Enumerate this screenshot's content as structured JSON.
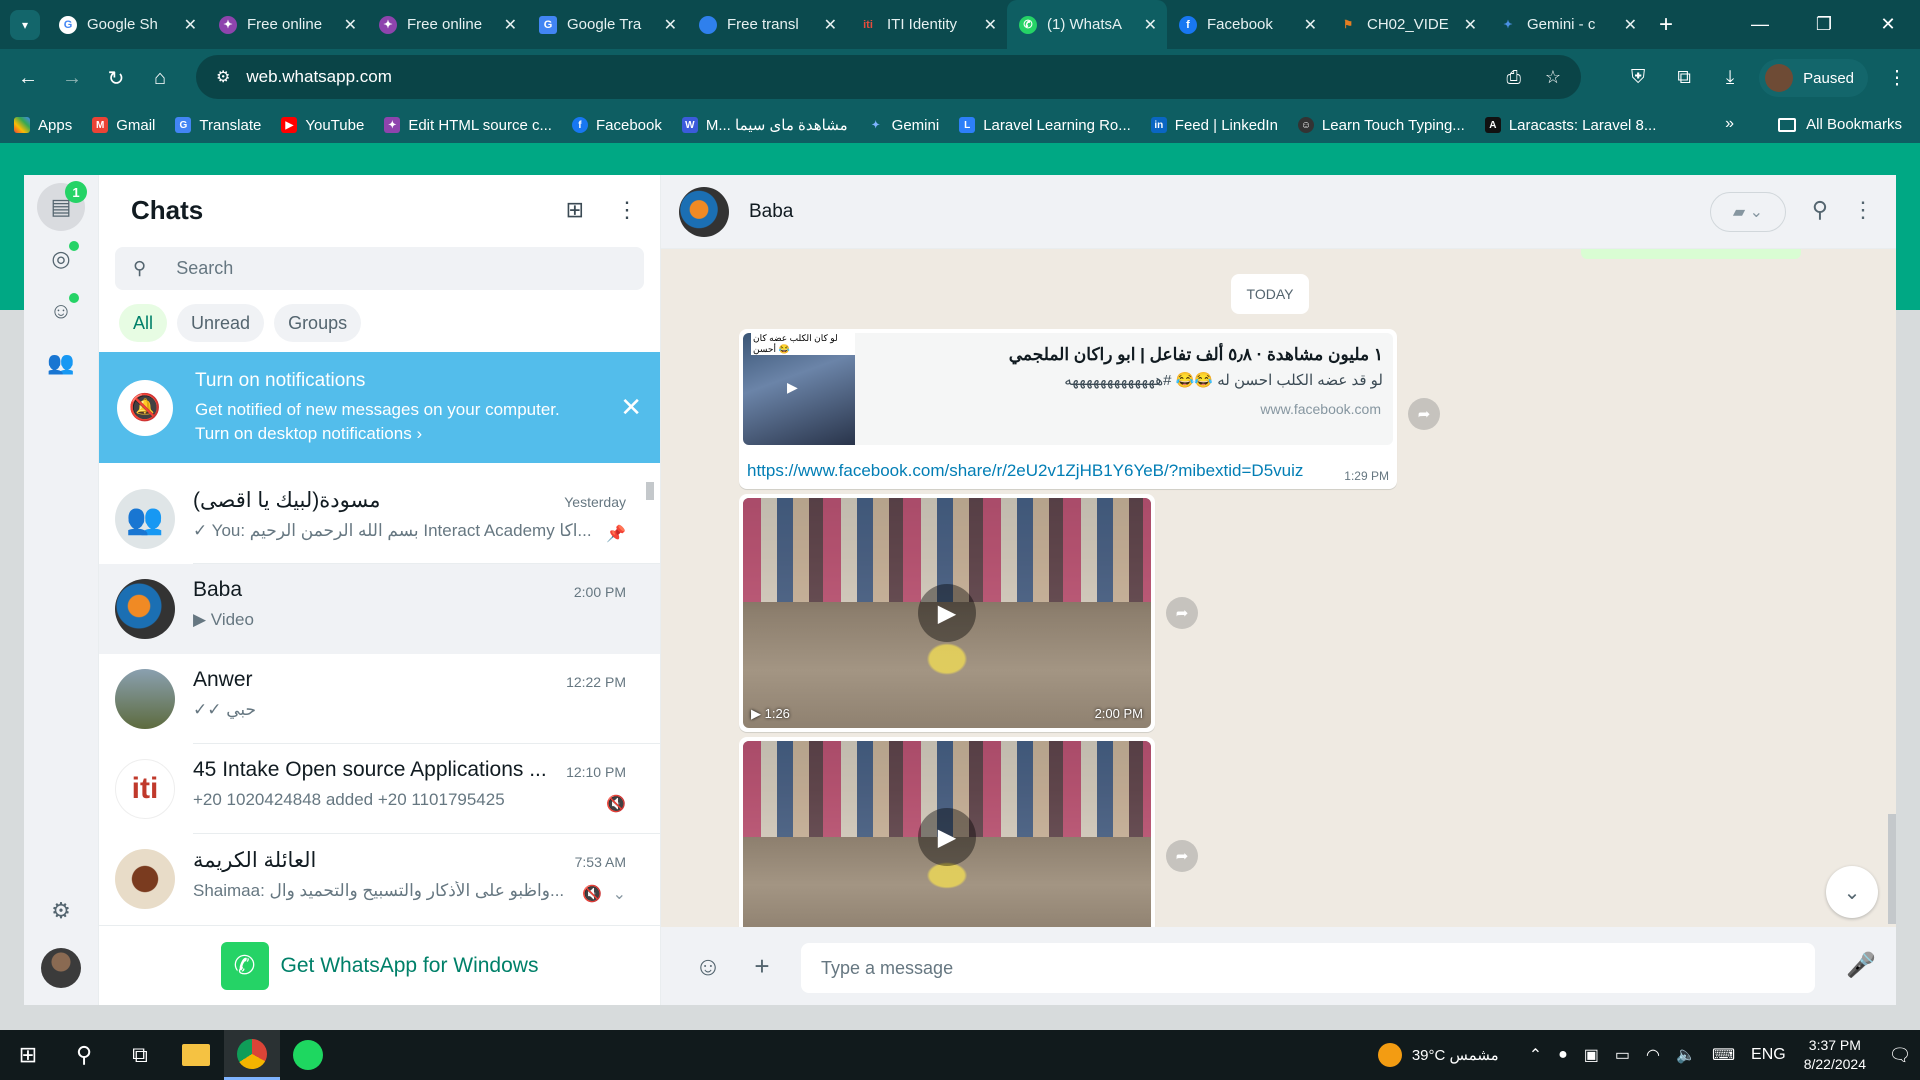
{
  "browser": {
    "tabs": [
      {
        "title": "Google Sh",
        "icon": "google-icon",
        "color": "#ffffff"
      },
      {
        "title": "Free online",
        "icon": "puzzle-icon",
        "color": "#8e44ad"
      },
      {
        "title": "Free online",
        "icon": "puzzle-icon",
        "color": "#8e44ad"
      },
      {
        "title": "Google Tra",
        "icon": "translate-icon",
        "color": "#4285f4"
      },
      {
        "title": "Free transl",
        "icon": "globe-icon",
        "color": "#2f80ed"
      },
      {
        "title": "ITI Identity",
        "icon": "iti-icon",
        "color": "#c0392b"
      },
      {
        "title": "(1) WhatsA",
        "icon": "whatsapp-icon",
        "color": "#25d366"
      },
      {
        "title": "Facebook",
        "icon": "facebook-icon",
        "color": "#1877f2"
      },
      {
        "title": "CH02_VIDE",
        "icon": "file-icon",
        "color": "#e67e22"
      },
      {
        "title": "Gemini - c",
        "icon": "gemini-icon",
        "color": "#4a90e2"
      }
    ],
    "url": "web.whatsapp.com",
    "profile_label": "Paused",
    "bookmarks": [
      {
        "label": "Apps",
        "color": "#e74c3c"
      },
      {
        "label": "Gmail",
        "color": "#ea4335"
      },
      {
        "label": "Translate",
        "color": "#4285f4"
      },
      {
        "label": "YouTube",
        "color": "#ff0000"
      },
      {
        "label": "Edit HTML source c...",
        "color": "#8e44ad"
      },
      {
        "label": "Facebook",
        "color": "#1877f2"
      },
      {
        "label": "M... مشاهدة ماى سيما",
        "color": "#3b5bdb"
      },
      {
        "label": "Gemini",
        "color": "#4a90e2"
      },
      {
        "label": "Laravel Learning Ro...",
        "color": "#2d7ff9"
      },
      {
        "label": "Feed | LinkedIn",
        "color": "#0a66c2"
      },
      {
        "label": "Learn Touch Typing...",
        "color": "#333333"
      },
      {
        "label": "Laracasts: Laravel 8...",
        "color": "#111111"
      }
    ],
    "all_bookmarks": "All Bookmarks"
  },
  "whatsapp": {
    "rail": {
      "chats_badge": "1"
    },
    "sidebar": {
      "title": "Chats",
      "search_placeholder": "Search",
      "filters": [
        "All",
        "Unread",
        "Groups"
      ],
      "notification": {
        "title": "Turn on notifications",
        "desc": "Get notified of new messages on your computer.",
        "link": "Turn on desktop notifications ›"
      },
      "chats": [
        {
          "name": "مسودة(لبيك يا اقصى)",
          "time": "Yesterday",
          "preview": "✓ You:  بسم الله الرحمن الرحيم  Interact Academy  اكا...",
          "right_icon": "pin-icon",
          "avatar_color": "#dfe5e7"
        },
        {
          "name": "Baba",
          "time": "2:00 PM",
          "preview": "▶ Video",
          "right_icon": "",
          "avatar_color": "#1b6fb3"
        },
        {
          "name": "Anwer",
          "time": "12:22 PM",
          "preview": "✓✓ حبي",
          "right_icon": "",
          "avatar_color": "#6b7a4a"
        },
        {
          "name": "45 Intake Open source Applications ...",
          "time": "12:10 PM",
          "preview": "+20 1020424848 added +20 1101795425",
          "right_icon": "muted-icon",
          "avatar_color": "#ffffff"
        },
        {
          "name": "العائلة الكريمة",
          "time": "7:53 AM",
          "preview": "Shaimaa: واظبو على الأذكار  والتسبيح والتحميد وال...",
          "right_icon": "muted-icon",
          "avatar_color": "#e8dcc8"
        }
      ],
      "get_windows": "Get WhatsApp for Windows"
    },
    "conversation": {
      "contact": "Baba",
      "day_label": "TODAY",
      "link_message": {
        "title": "١ مليون مشاهدة · ٥٫٨ ألف تفاعل | ابو راكان الملجمي",
        "desc": "لو قد عضه الكلب احسن له 😂😂 #هههههههههههههه",
        "domain": "www.facebook.com",
        "url": "https://www.facebook.com/share/r/2eU2v1ZjHB1Y6YeB/?mibextid=D5vuiz",
        "time": "1:29 PM",
        "thumb_caption": "لو كان الكلب عضه كان أحسن 😂"
      },
      "videos": [
        {
          "duration": "1:26",
          "time": "2:00 PM"
        },
        {
          "duration": "",
          "time": ""
        }
      ],
      "composer_placeholder": "Type a message"
    }
  },
  "taskbar": {
    "weather": "39°C  مشمس",
    "lang": "ENG",
    "time": "3:37 PM",
    "date": "8/22/2024"
  }
}
